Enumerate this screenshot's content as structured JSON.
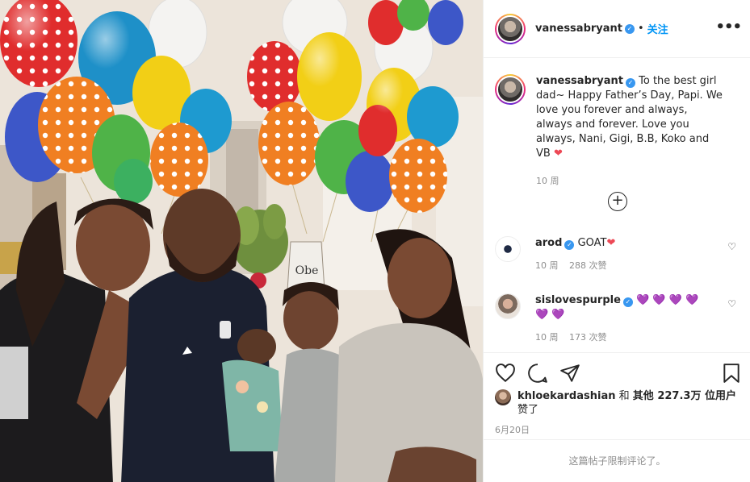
{
  "post": {
    "author": "vanessabryant",
    "verified_mark": "✓",
    "follow_label": "关注",
    "more_icon": "more-horizontal-icon",
    "caption": {
      "author": "vanessabryant",
      "text": "To the best girl dad~ Happy Father’s Day, Papi. We love you forever and always, always and forever. Love you always, Nani, Gigi, B.B, Koko and VB",
      "emoji": "❤",
      "time": "10 周"
    },
    "load_more_label": "+",
    "comments": [
      {
        "user": "arod",
        "text": "GOAT",
        "emoji": "❤",
        "time": "10 周",
        "likes": "288 次赞"
      },
      {
        "user": "sislovespurple",
        "text": "",
        "emoji": "💜 💜 💜 💜 💜 💜",
        "time": "10 周",
        "likes": "173 次赞"
      }
    ],
    "liked_by": {
      "user": "khloekardashian",
      "and": "和",
      "others": "其他 227.3万 位用户",
      "suffix": "赞了"
    },
    "date": "6月20日",
    "comments_limited": "这篇帖子限制评论了。",
    "photo_tag_text": "Obe",
    "colors": {
      "accent": "#0095f6",
      "verified": "#3897f0",
      "muted": "#8e8e8e",
      "heart": "#ed4956"
    }
  }
}
